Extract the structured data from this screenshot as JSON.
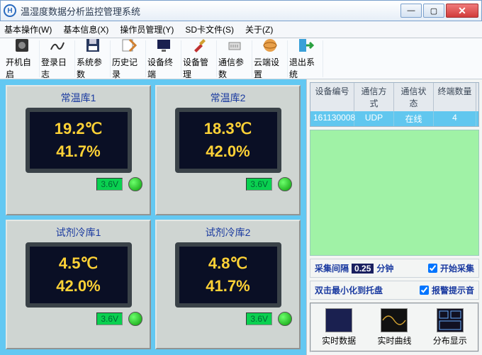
{
  "window": {
    "title": "温湿度数据分析监控管理系统",
    "logo_letter": "H"
  },
  "menu": {
    "basic_op": "基本操作(W)",
    "basic_info": "基本信息(X)",
    "operator": "操作员管理(Y)",
    "sdcard": "SD卡文件(S)",
    "about": "关于(Z)"
  },
  "toolbar": {
    "autostart": "开机自启",
    "loginlog": "登录日志",
    "sysparam": "系统参数",
    "history": "历史记录",
    "terminal": "设备终端",
    "devmgr": "设备管理",
    "commparam": "通信参数",
    "cloud": "云端设置",
    "exit": "退出系统"
  },
  "devices": [
    {
      "name": "常温库1",
      "temp": "19.2℃",
      "humid": "41.7%",
      "volt": "3.6V"
    },
    {
      "name": "常温库2",
      "temp": "18.3℃",
      "humid": "42.0%",
      "volt": "3.6V"
    },
    {
      "name": "试剂冷库1",
      "temp": "4.5℃",
      "humid": "42.0%",
      "volt": "3.6V"
    },
    {
      "name": "试剂冷库2",
      "temp": "4.8℃",
      "humid": "41.7%",
      "volt": "3.6V"
    }
  ],
  "table": {
    "headers": {
      "id": "设备编号",
      "comm": "通信方式",
      "status": "通信状态",
      "count": "终端数量"
    },
    "row": {
      "id": "161130008",
      "comm": "UDP",
      "status": "在线",
      "count": "4"
    }
  },
  "config": {
    "interval_label": "采集间隔",
    "interval_value": "0.25",
    "interval_unit": "分钟",
    "start_collect": "开始采集",
    "dblclick_tray": "双击最小化到托盘",
    "alarm_sound": "报警提示音"
  },
  "buttons": {
    "realtime_data": "实时数据",
    "realtime_curve": "实时曲线",
    "distribution": "分布显示"
  }
}
